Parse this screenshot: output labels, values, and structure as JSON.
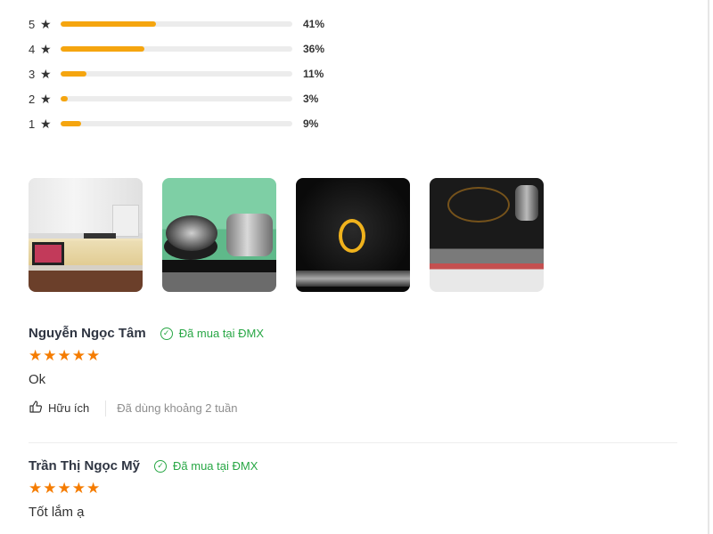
{
  "rating_breakdown": [
    {
      "stars": "5",
      "percent_label": "41%",
      "fraction": 0.41
    },
    {
      "stars": "4",
      "percent_label": "36%",
      "fraction": 0.36
    },
    {
      "stars": "3",
      "percent_label": "11%",
      "fraction": 0.11
    },
    {
      "stars": "2",
      "percent_label": "3%",
      "fraction": 0.03
    },
    {
      "stars": "1",
      "percent_label": "9%",
      "fraction": 0.09
    }
  ],
  "icons": {
    "star": "★",
    "verified": "✓",
    "like": "👍"
  },
  "photos": [
    "kitchen-photo",
    "pots-on-cooktop-photo",
    "cooktop-ring-photo",
    "cooktop-counter-photo"
  ],
  "reviews": [
    {
      "name": "Nguyễn Ngọc Tâm",
      "verified": "Đã mua tại ĐMX",
      "stars": 5,
      "text": "Ok",
      "helpful": "Hữu ích",
      "usage": "Đã dùng khoảng 2 tuần"
    },
    {
      "name": "Trần Thị Ngọc Mỹ",
      "verified": "Đã mua tại ĐMX",
      "stars": 5,
      "text": "Tốt lắm ạ"
    }
  ],
  "colors": {
    "bar": "#f5a50f",
    "review_star": "#f57c00",
    "verified": "#28a745"
  }
}
